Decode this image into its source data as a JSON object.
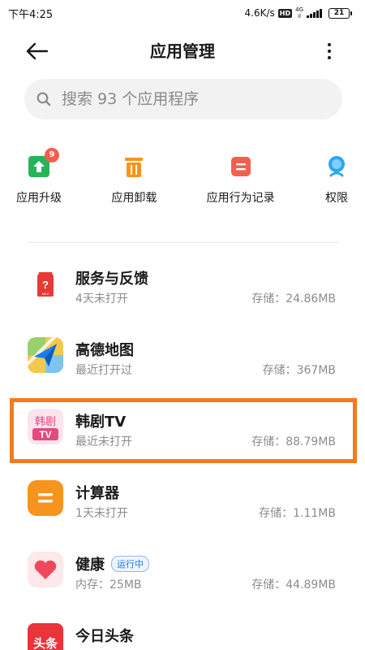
{
  "status_bar": {
    "time": "下午4:25",
    "net_speed": "4.6K/s",
    "hd": "HD",
    "net_type_top": "4G",
    "net_type_bottom": "ıl",
    "battery": "21"
  },
  "header": {
    "title": "应用管理"
  },
  "search": {
    "placeholder": "搜索 93 个应用程序"
  },
  "shortcuts": [
    {
      "label": "应用升级",
      "icon": "upgrade-icon",
      "badge": "9"
    },
    {
      "label": "应用卸载",
      "icon": "trash-icon"
    },
    {
      "label": "应用行为记录",
      "icon": "record-icon"
    },
    {
      "label": "权限",
      "icon": "permission-icon"
    }
  ],
  "apps": [
    {
      "name": "服务与反馈",
      "status": "4天未打开",
      "storage": "存储：24.86MB",
      "icon": "feedback-app-icon",
      "icon_text": "?",
      "icon_sub": "MIUI"
    },
    {
      "name": "高德地图",
      "status": "最近打开过",
      "storage": "存储：367MB",
      "icon": "amap-app-icon"
    },
    {
      "name": "韩剧TV",
      "status": "最近未打开",
      "storage": "存储：88.79MB",
      "icon": "hanju-tv-app-icon",
      "icon_text_top": "韩剧",
      "icon_text_bottom": "TV"
    },
    {
      "name": "计算器",
      "status": "1天未打开",
      "storage": "存储：1.11MB",
      "icon": "calculator-app-icon"
    },
    {
      "name": "健康",
      "tag": "运行中",
      "status": "内存：25MB",
      "storage": "存储：44.89MB",
      "icon": "health-app-icon"
    },
    {
      "name": "今日头条",
      "icon": "toutiao-app-icon",
      "icon_text": "头条"
    }
  ],
  "colors": {
    "highlight": "#f47a20",
    "upgrade": "#27b35a",
    "uninstall": "#f7941d",
    "record": "#f25f4c",
    "permission": "#2ba7f0",
    "running_tag": "#1b73e8"
  }
}
